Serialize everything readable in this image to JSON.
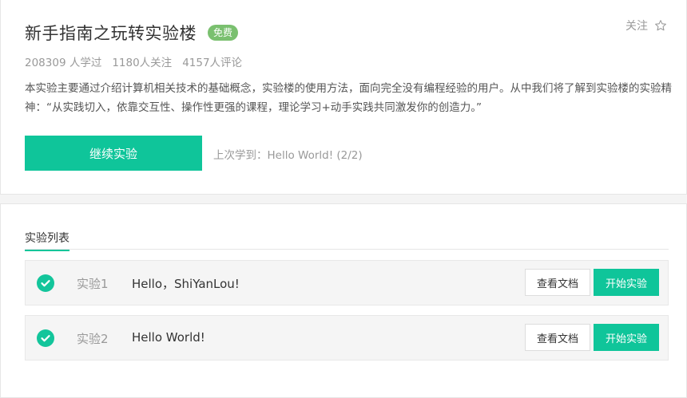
{
  "course": {
    "title": "新手指南之玩转实验楼",
    "badge": "免费",
    "follow_label": "关注",
    "stats": {
      "learners": "208309 人学过",
      "followers": "1180人关注",
      "comments": "4157人评论"
    },
    "description": "本实验主要通过介绍计算机相关技术的基础概念，实验楼的使用方法，面向完全没有编程经验的用户。从中我们将了解到实验楼的实验精神：“从实践切入，依靠交互性、操作性更强的课程，理论学习+动手实践共同激发你的创造力。”",
    "continue_label": "继续实验",
    "last_learned": "上次学到：Hello World!  (2/2)"
  },
  "lab_list": {
    "title": "实验列表",
    "labs": [
      {
        "num": "实验1",
        "name": "Hello，ShiYanLou!",
        "doc_label": "查看文档",
        "start_label": "开始实验"
      },
      {
        "num": "实验2",
        "name": "Hello World!",
        "doc_label": "查看文档",
        "start_label": "开始实验"
      }
    ]
  },
  "colors": {
    "accent": "#0fc59a",
    "badge": "#7ac06f"
  }
}
